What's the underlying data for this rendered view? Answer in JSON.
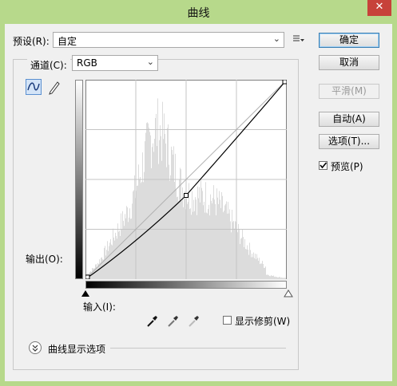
{
  "window": {
    "title": "曲线",
    "close_glyph": "✕"
  },
  "preset": {
    "label": "预设(R):",
    "value": "自定"
  },
  "channel": {
    "label": "通道(C):",
    "value": "RGB"
  },
  "graph": {
    "output_label": "输出(O):",
    "input_label": "输入(I):",
    "curve_points": [
      [
        0,
        0
      ],
      [
        0.5,
        0.42
      ],
      [
        1,
        1
      ]
    ]
  },
  "buttons": {
    "ok": "确定",
    "cancel": "取消",
    "smooth": "平滑(M)",
    "auto": "自动(A)",
    "options": "选项(T)..."
  },
  "preview": {
    "label": "预览(P)",
    "checked": true
  },
  "clipping": {
    "label": "显示修剪(W)",
    "checked": false
  },
  "curve_display_options": {
    "label": "曲线显示选项"
  },
  "icons": [
    "preset-menu-icon",
    "curve-edit-tool-icon",
    "pencil-tool-icon",
    "black-eyedropper-icon",
    "gray-eyedropper-icon",
    "white-eyedropper-icon",
    "expand-chevron-icon"
  ]
}
